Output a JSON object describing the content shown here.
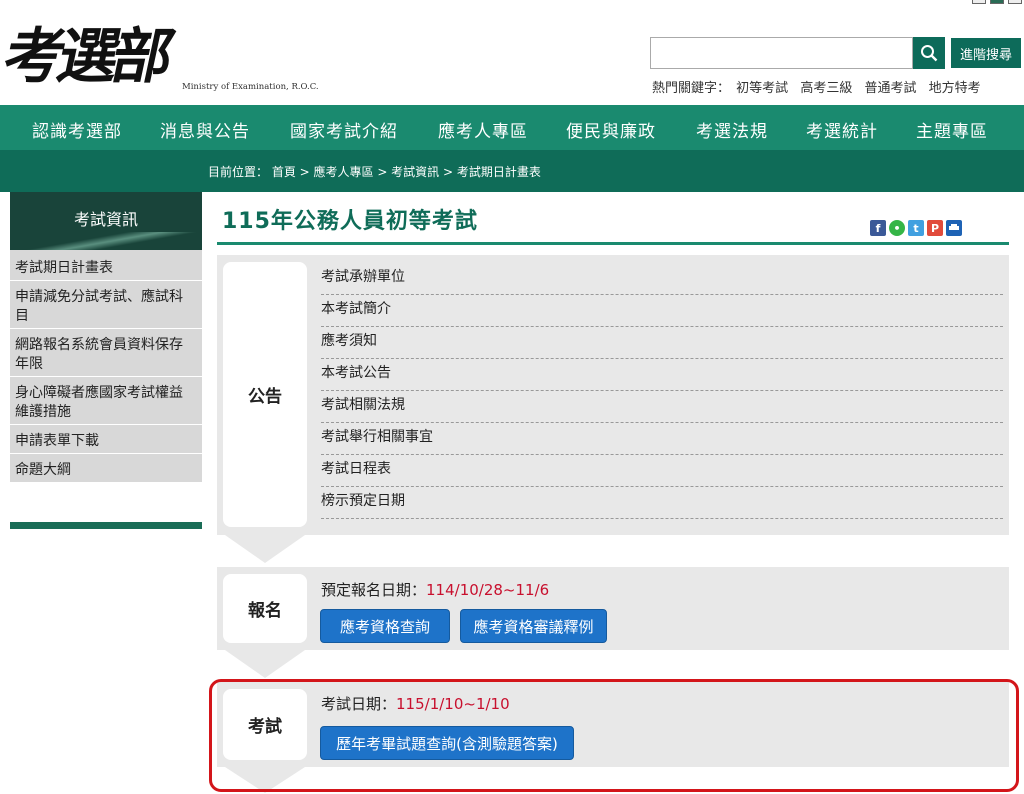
{
  "header": {
    "logo_text": "考選部",
    "logo_en": "Ministry of Examination, R.O.C.",
    "search_placeholder": "",
    "advanced_label": "進階搜尋",
    "hot_label": "熱門關鍵字：",
    "hot_keywords": [
      "初等考試",
      "高考三級",
      "普通考試",
      "地方特考"
    ]
  },
  "nav": [
    "認識考選部",
    "消息與公告",
    "國家考試介紹",
    "應考人專區",
    "便民與廉政",
    "考選法規",
    "考選統計",
    "主題專區"
  ],
  "breadcrumb": "目前位置： 首頁 > 應考人專區 > 考試資訊 > 考試期日計畫表",
  "sidebar": {
    "title": "考試資訊",
    "items": [
      "考試期日計畫表",
      "申請減免分試考試、應試科目",
      "網路報名系統會員資料保存年限",
      "身心障礙者應國家考試權益維護措施",
      "申請表單下載",
      "命題大綱"
    ]
  },
  "main": {
    "title": "115年公務人員初等考試",
    "share_icons": [
      "facebook-icon",
      "line-icon",
      "twitter-icon",
      "plurk-icon",
      "print-icon"
    ],
    "announce": {
      "tag": "公告",
      "links": [
        "考試承辦單位",
        "本考試簡介",
        "應考須知",
        "本考試公告",
        "考試相關法規",
        "考試舉行相關事宜",
        "考試日程表",
        "榜示預定日期"
      ]
    },
    "register": {
      "tag": "報名",
      "label": "預定報名日期：",
      "value": "114/10/28~11/6",
      "buttons": [
        "應考資格查詢",
        "應考資格審議釋例"
      ]
    },
    "exam": {
      "tag": "考試",
      "label": "考試日期：",
      "value": "115/1/10~1/10",
      "button": "歷年考畢試題查詢(含測驗題答案)"
    }
  },
  "colors": {
    "nav": "#1a8a6f",
    "breadbar": "#0f6c58",
    "accent_red": "#c8102e",
    "button_blue": "#1e73c9"
  }
}
